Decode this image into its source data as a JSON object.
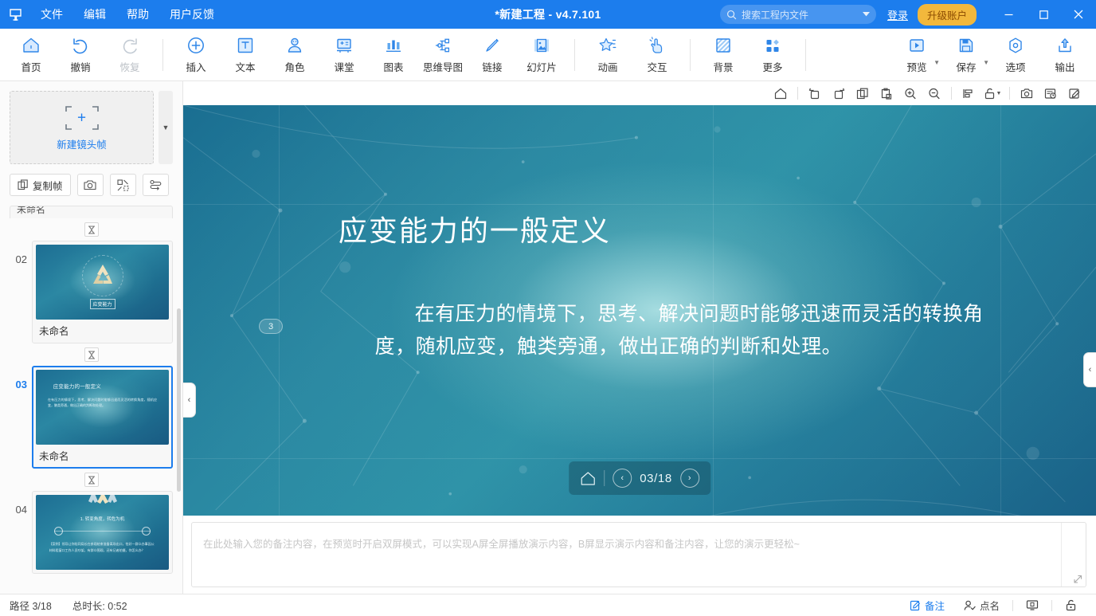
{
  "titlebar": {
    "logo_icon": "app-logo-icon",
    "menus": [
      {
        "label": "文件"
      },
      {
        "label": "编辑"
      },
      {
        "label": "帮助"
      },
      {
        "label": "用户反馈"
      }
    ],
    "title": "*新建工程 - v4.7.101",
    "search_placeholder": "搜索工程内文件",
    "search_icon": "search-icon",
    "search_caret_icon": "chevron-down-icon",
    "login_label": "登录",
    "upgrade_label": "升级账户",
    "minimize_icon": "minimize-icon",
    "maximize_icon": "maximize-icon",
    "close_icon": "close-icon",
    "accent": "#1c7ded",
    "upgrade_bg": "#f2b83c"
  },
  "ribbon": {
    "groups": [
      {
        "items": [
          {
            "label": "首页",
            "icon": "home-icon",
            "disabled": false,
            "caret": false
          },
          {
            "label": "撤销",
            "icon": "undo-icon",
            "disabled": false,
            "caret": false
          },
          {
            "label": "恢复",
            "icon": "redo-icon",
            "disabled": true,
            "caret": false
          }
        ]
      },
      {
        "items": [
          {
            "label": "插入",
            "icon": "plus-circle-icon",
            "disabled": false,
            "caret": false
          },
          {
            "label": "文本",
            "icon": "text-box-icon",
            "disabled": false,
            "caret": false
          },
          {
            "label": "角色",
            "icon": "character-icon",
            "disabled": false,
            "caret": false
          },
          {
            "label": "课堂",
            "icon": "classroom-icon",
            "disabled": false,
            "caret": false
          },
          {
            "label": "图表",
            "icon": "bar-chart-icon",
            "disabled": false,
            "caret": false
          },
          {
            "label": "思维导图",
            "icon": "mindmap-icon",
            "disabled": false,
            "caret": false
          },
          {
            "label": "链接",
            "icon": "link-pen-icon",
            "disabled": false,
            "caret": false
          },
          {
            "label": "幻灯片",
            "icon": "slide-image-icon",
            "disabled": false,
            "caret": false
          }
        ]
      },
      {
        "items": [
          {
            "label": "动画",
            "icon": "star-animation-icon",
            "disabled": false,
            "caret": false
          },
          {
            "label": "交互",
            "icon": "hand-click-icon",
            "disabled": false,
            "caret": false
          }
        ]
      },
      {
        "items": [
          {
            "label": "背景",
            "icon": "background-icon",
            "disabled": false,
            "caret": false
          },
          {
            "label": "更多",
            "icon": "more-grid-icon",
            "disabled": false,
            "caret": false
          }
        ]
      },
      {
        "items": [
          {
            "label": "预览",
            "icon": "preview-play-icon",
            "disabled": false,
            "caret": true
          },
          {
            "label": "保存",
            "icon": "save-disk-icon",
            "disabled": false,
            "caret": true
          },
          {
            "label": "选项",
            "icon": "options-gear-icon",
            "disabled": false,
            "caret": false
          },
          {
            "label": "输出",
            "icon": "export-upload-icon",
            "disabled": false,
            "caret": false
          }
        ]
      }
    ]
  },
  "leftpanel": {
    "new_frame_label": "新建镜头帧",
    "new_frame_plus_icon": "plus-icon",
    "scroll_down_icon": "caret-down-icon",
    "tools": [
      {
        "label": "复制帧",
        "icon": "copy-frame-icon"
      },
      {
        "label": "",
        "icon": "camera-icon"
      },
      {
        "label": "",
        "icon": "fit-frame-icon"
      },
      {
        "label": "",
        "icon": "reorder-path-icon"
      }
    ],
    "partial_top_label": "未命名",
    "connector_icon": "hourglass-transition-icon",
    "slides": [
      {
        "number": "02",
        "name": "未命名",
        "active": false,
        "kind": "icon-badge",
        "badge_text": "应变能力"
      },
      {
        "number": "03",
        "name": "未命名",
        "active": true,
        "kind": "text",
        "title": "应变能力的一般定义",
        "body": "在有压力的情境下，思考、解决问题时能够迅速而灵活的转换角度，随机应变，触类旁通，做出正确的判断和处理。"
      },
      {
        "number": "04",
        "name": "",
        "active": false,
        "kind": "timeline",
        "title": "1. 转变角度，转危为机",
        "body": "【案例】领导让你陪同局长在参观结束准备离场出口，恰好一群众办事因公材料租窗口工作人员吵架，有群众围观，还有记者拍摄，你怎么办？"
      }
    ]
  },
  "canvas_toolbar": {
    "buttons": [
      {
        "icon": "home-outline-icon",
        "caret": false
      },
      {
        "icon": "rotate-left-icon",
        "caret": false
      },
      {
        "icon": "rotate-right-icon",
        "caret": false
      },
      {
        "icon": "copy-icon",
        "caret": false
      },
      {
        "icon": "paste-icon",
        "caret": false
      },
      {
        "icon": "zoom-in-icon",
        "caret": false
      },
      {
        "icon": "zoom-out-icon",
        "caret": false
      },
      {
        "icon": "align-icon",
        "caret": false
      },
      {
        "icon": "unlock-icon",
        "caret": true
      },
      {
        "icon": "snapshot-icon",
        "caret": false
      },
      {
        "icon": "timeline-record-icon",
        "caret": false
      },
      {
        "icon": "edit-note-icon",
        "caret": false
      }
    ]
  },
  "slide": {
    "title": "应变能力的一般定义",
    "body_line1_indent": "　　",
    "body": "在有压力的情境下，思考、解决问题时能够迅速而灵活的转换角度，随机应变，触类旁通，做出正确的判断和处理。",
    "badge_number": "3",
    "playbar": {
      "home_icon": "home-outline-icon",
      "prev_icon": "chevron-left-icon",
      "next_icon": "chevron-right-icon",
      "counter": "03/18"
    },
    "collapse_left_icon": "chevron-left-icon",
    "collapse_right_icon": "chevron-left-icon"
  },
  "notes": {
    "placeholder": "在此处输入您的备注内容，在预览时开启双屏模式，可以实现A屏全屏播放演示内容，B屏显示演示内容和备注内容，让您的演示更轻松~",
    "resize_icon": "resize-handle-icon"
  },
  "statusbar": {
    "path_label": "路径 3/18",
    "duration_label": "总时长: 0:52",
    "notes_button": {
      "label": "备注",
      "icon": "note-edit-icon",
      "active": true
    },
    "rollcall_button": {
      "label": "点名",
      "icon": "rollcall-person-icon",
      "active": false
    },
    "screen_icon": "dual-screen-icon",
    "lock_icon": "lock-icon"
  }
}
